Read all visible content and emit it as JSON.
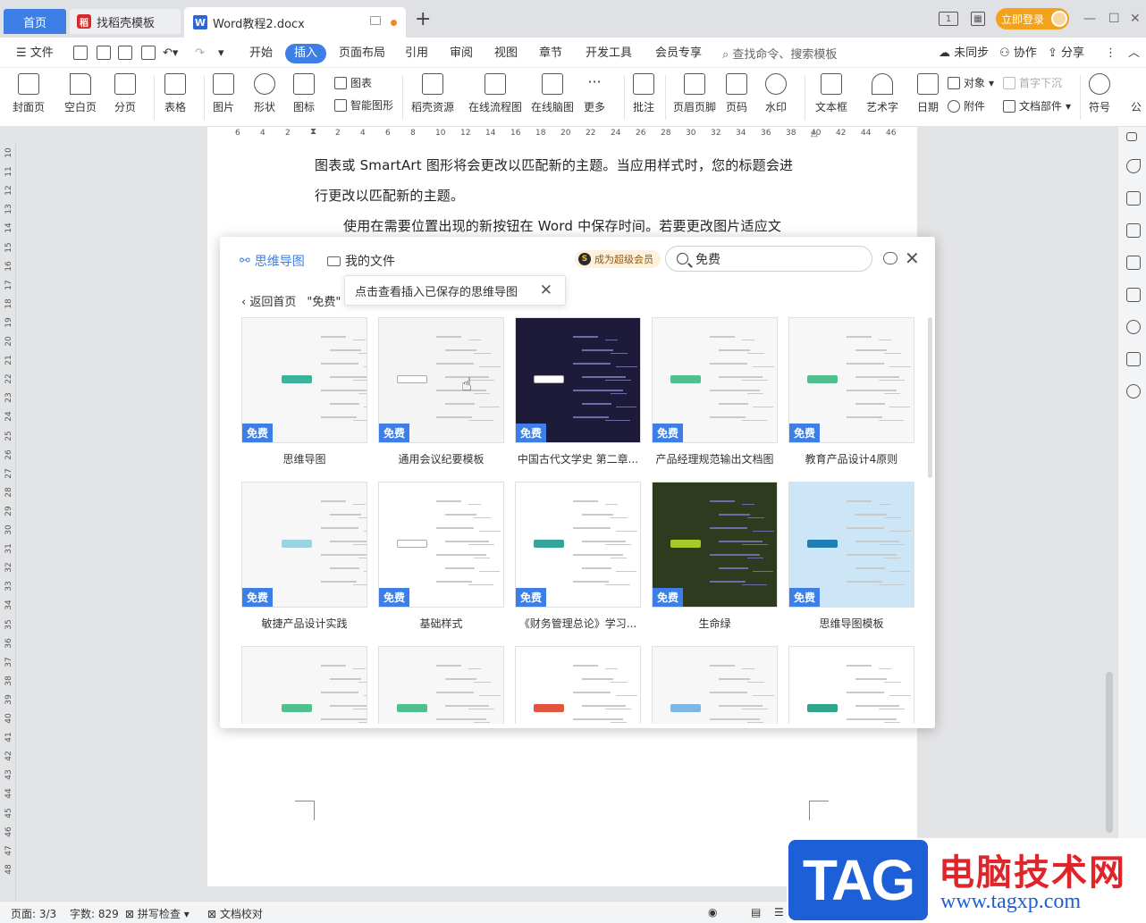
{
  "titlebar": {
    "home_tab": "首页",
    "daoke_tab": "找稻壳模板",
    "doc_tab": "Word教程2.docx",
    "login_btn": "立即登录"
  },
  "menu": {
    "file": "文件",
    "items": [
      "开始",
      "插入",
      "页面布局",
      "引用",
      "审阅",
      "视图",
      "章节",
      "开发工具",
      "会员专享"
    ],
    "active": "插入",
    "search": "查找命令、搜索模板",
    "sync": "未同步",
    "collab": "协作",
    "share": "分享"
  },
  "ribbon": {
    "cover": "封面页",
    "blank": "空白页",
    "pagebreak": "分页",
    "table": "表格",
    "picture": "图片",
    "shape": "形状",
    "icon": "图标",
    "chart": "图表",
    "smartart": "智能图形",
    "daoke_res": "稻壳资源",
    "flowchart": "在线流程图",
    "mindmap": "在线脑图",
    "more": "更多",
    "comment": "批注",
    "header_footer": "页眉页脚",
    "page_num": "页码",
    "watermark": "水印",
    "textbox": "文本框",
    "wordart": "艺术字",
    "date": "日期",
    "object": "对象",
    "dropcap": "首字下沉",
    "attachment": "附件",
    "docpart": "文档部件",
    "symbol": "符号",
    "formula_short": "公"
  },
  "ruler": {
    "h_left": [
      "6",
      "4",
      "2"
    ],
    "h_right": [
      "2",
      "4",
      "6",
      "8",
      "10",
      "12",
      "14",
      "16",
      "18",
      "20",
      "22",
      "24",
      "26",
      "28",
      "30",
      "32",
      "34",
      "36",
      "38",
      "40",
      "42",
      "44",
      "46"
    ],
    "v": [
      "10",
      "11",
      "12",
      "13",
      "14",
      "15",
      "16",
      "17",
      "18",
      "19",
      "20",
      "21",
      "22",
      "23",
      "24",
      "25",
      "26",
      "27",
      "28",
      "29",
      "30",
      "31",
      "32",
      "33",
      "34",
      "35",
      "36",
      "37",
      "38",
      "39",
      "40",
      "41",
      "42",
      "43",
      "44",
      "45",
      "46",
      "47",
      "48"
    ]
  },
  "document": {
    "line1": "图表或 SmartArt 图形将会更改以匹配新的主题。当应用样式时，您的标题会进",
    "line2": "行更改以匹配新的主题。",
    "line3": "使用在需要位置出现的新按钮在 Word 中保存时间。若要更改图片适应文"
  },
  "dialog": {
    "tab_mindmap": "思维导图",
    "tab_myfiles": "我的文件",
    "vip": "成为超级会员",
    "search_value": "免费",
    "back": "返回首页",
    "filter": "\"免费\"",
    "tooltip": "点击查看插入已保存的思维导图",
    "free_badge": "免费",
    "cards": [
      {
        "title": "思维导图",
        "bg": "#f6f6f6",
        "center": "#3bb39a"
      },
      {
        "title": "通用会议纪要模板",
        "bg": "#f4f4f4",
        "center": "#ffffff"
      },
      {
        "title": "中国古代文学史 第二章...",
        "bg": "#1d1a3a",
        "center": "#ffffff"
      },
      {
        "title": "产品经理规范输出文档图",
        "bg": "#f7f7f7",
        "center": "#4fc08d"
      },
      {
        "title": "教育产品设计4原则",
        "bg": "#f7f7f7",
        "center": "#4fc08d"
      },
      {
        "title": "敏捷产品设计实践",
        "bg": "#f7f7f7",
        "center": "#9ad3e2"
      },
      {
        "title": "基础样式",
        "bg": "#ffffff",
        "center": "#ffffff"
      },
      {
        "title": "《财务管理总论》学习...",
        "bg": "#ffffff",
        "center": "#35a59b"
      },
      {
        "title": "生命绿",
        "bg": "#2f3b1f",
        "center": "#a8c82a"
      },
      {
        "title": "思维导图模板",
        "bg": "#cde6f7",
        "center": "#1f7fb3"
      },
      {
        "title": "",
        "bg": "#f7f7f7",
        "center": "#4fc08d"
      },
      {
        "title": "",
        "bg": "#f7f7f7",
        "center": "#4fc08d"
      },
      {
        "title": "",
        "bg": "#ffffff",
        "center": "#e2553c"
      },
      {
        "title": "",
        "bg": "#f7f7f7",
        "center": "#7ab7e6"
      },
      {
        "title": "",
        "bg": "#ffffff",
        "center": "#2fa58c"
      }
    ]
  },
  "statusbar": {
    "page": "页面: 3/3",
    "words": "字数: 829",
    "spell": "拼写检查",
    "proof": "文档校对"
  },
  "watermark": {
    "tag": "TAG",
    "cn": "电脑技术网",
    "url": "www.tagxp.com"
  }
}
